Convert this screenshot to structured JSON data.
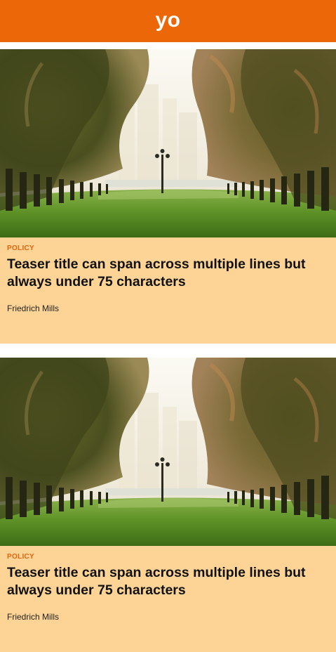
{
  "header": {
    "logo_text": "yo",
    "background_color": "#ec6708"
  },
  "teasers": [
    {
      "category": "POLICY",
      "title": "Teaser title can span across multiple lines but always under 75 characters",
      "author": "Friedrich Mills",
      "image_alt": "Rows of palm trees along a green lawn"
    },
    {
      "category": "POLICY",
      "title": "Teaser title can span across multiple lines but always under 75 characters",
      "author": "Friedrich Mills",
      "image_alt": "Rows of palm trees along a green lawn"
    }
  ],
  "colors": {
    "card_background": "#fdd495",
    "category": "#e3650c",
    "title": "#111111"
  }
}
